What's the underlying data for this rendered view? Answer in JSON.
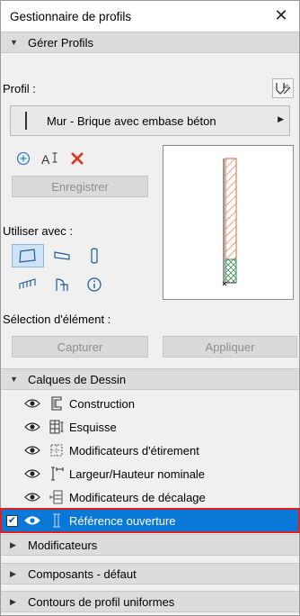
{
  "window": {
    "title": "Gestionnaire de profils",
    "close_glyph": "✕"
  },
  "sections": {
    "gerer_profils": "Gérer Profils",
    "calques": "Calques de Dessin",
    "modificateurs": "Modificateurs",
    "composants": "Composants - défaut",
    "contours": "Contours de profil uniformes"
  },
  "profil": {
    "label": "Profil :",
    "selected": "Mur - Brique avec embase béton",
    "icon": "profile-settings-icon"
  },
  "tools": {
    "add_icon": "add-icon",
    "rename_icon": "rename-icon",
    "delete_icon": "delete-icon",
    "save_label": "Enregistrer"
  },
  "use_with": {
    "label": "Utiliser avec :",
    "items": [
      {
        "icon": "wall-icon",
        "selected": true
      },
      {
        "icon": "beam-icon",
        "selected": false
      },
      {
        "icon": "column-icon",
        "selected": false
      },
      {
        "icon": "railing-icon",
        "selected": false
      },
      {
        "icon": "opening-icon",
        "selected": false
      },
      {
        "icon": "info-icon",
        "selected": false
      }
    ]
  },
  "element_selection": {
    "label": "Sélection d'élément :",
    "capture_label": "Capturer",
    "apply_label": "Appliquer"
  },
  "layers": [
    {
      "name": "Construction",
      "checked": false,
      "selected": false,
      "icon": "construction-layer-icon"
    },
    {
      "name": "Esquisse",
      "checked": false,
      "selected": false,
      "icon": "sketch-layer-icon"
    },
    {
      "name": "Modificateurs d'étirement",
      "checked": false,
      "selected": false,
      "icon": "stretch-modifier-icon"
    },
    {
      "name": "Largeur/Hauteur nominale",
      "checked": false,
      "selected": false,
      "icon": "nominal-size-icon"
    },
    {
      "name": "Modificateurs de décalage",
      "checked": false,
      "selected": false,
      "icon": "offset-modifier-icon"
    },
    {
      "name": "Référence ouverture",
      "checked": true,
      "selected": true,
      "icon": "opening-reference-icon"
    }
  ],
  "colors": {
    "selection": "#0a78d7",
    "highlight_outline": "#e02020",
    "delete_red": "#e0301e",
    "add_blue": "#2a7fd4",
    "brick_hatch": "#d46a3a",
    "concrete_hatch": "#3a8a5a"
  }
}
